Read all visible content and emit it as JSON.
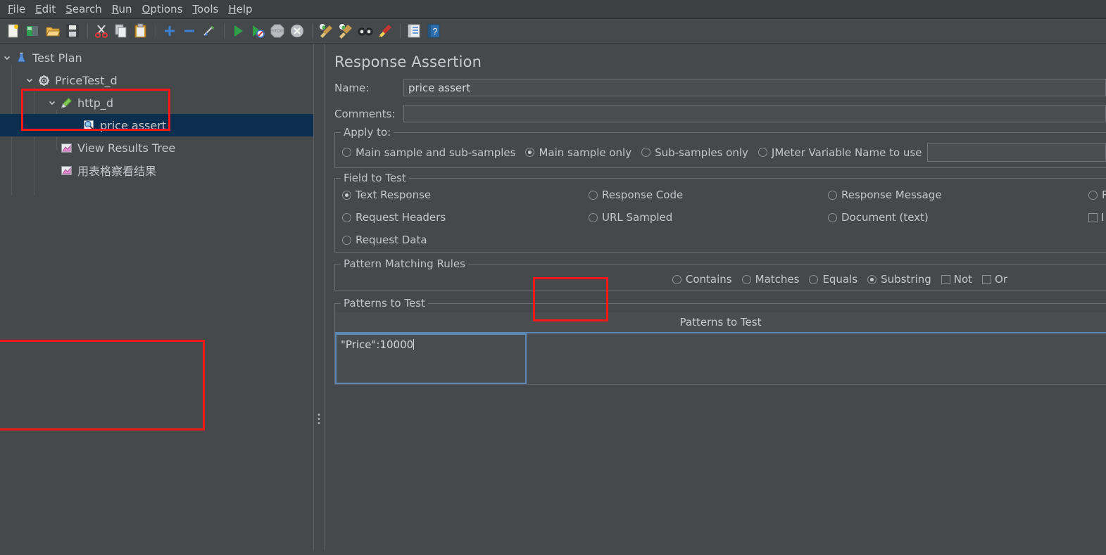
{
  "window": {
    "accent_blue": "#5b88b5",
    "selection_blue": "#0d2f4f",
    "annotation_red": "#f41818",
    "background": "#45494c"
  },
  "menubar": {
    "items": [
      {
        "label": "File",
        "mnemonic": "F"
      },
      {
        "label": "Edit",
        "mnemonic": "E"
      },
      {
        "label": "Search",
        "mnemonic": "S"
      },
      {
        "label": "Run",
        "mnemonic": "R"
      },
      {
        "label": "Options",
        "mnemonic": "O"
      },
      {
        "label": "Tools",
        "mnemonic": "T"
      },
      {
        "label": "Help",
        "mnemonic": "H"
      }
    ]
  },
  "toolbar": {
    "buttons": [
      {
        "name": "new-icon",
        "tooltip": "New"
      },
      {
        "name": "templates-icon",
        "tooltip": "Templates"
      },
      {
        "name": "open-icon",
        "tooltip": "Open"
      },
      {
        "name": "save-icon",
        "tooltip": "Save Test Plan"
      },
      {
        "name": "cut-icon",
        "tooltip": "Cut"
      },
      {
        "name": "copy-icon",
        "tooltip": "Copy"
      },
      {
        "name": "paste-icon",
        "tooltip": "Paste"
      },
      {
        "name": "expand-all-icon",
        "tooltip": "Expand All"
      },
      {
        "name": "collapse-all-icon",
        "tooltip": "Collapse All"
      },
      {
        "name": "toggle-icon",
        "tooltip": "Toggle"
      },
      {
        "name": "start-icon",
        "tooltip": "Start"
      },
      {
        "name": "start-no-pauses-icon",
        "tooltip": "Start no pauses"
      },
      {
        "name": "stop-icon",
        "tooltip": "Stop"
      },
      {
        "name": "shutdown-icon",
        "tooltip": "Shutdown"
      },
      {
        "name": "clear-icon",
        "tooltip": "Clear"
      },
      {
        "name": "clear-all-icon",
        "tooltip": "Clear All"
      },
      {
        "name": "search-icon",
        "tooltip": "Search"
      },
      {
        "name": "reset-search-icon",
        "tooltip": "Reset Search"
      },
      {
        "name": "function-helper-icon",
        "tooltip": "Function Helper Dialog"
      },
      {
        "name": "help-icon",
        "tooltip": "Help"
      }
    ]
  },
  "tree": {
    "nodes": [
      {
        "label": "Test Plan",
        "icon": "test-plan-icon",
        "depth": 0,
        "expanded": true,
        "selected": false,
        "has_toggle": true
      },
      {
        "label": "PriceTest_d",
        "icon": "thread-group-icon",
        "depth": 1,
        "expanded": true,
        "selected": false,
        "has_toggle": true
      },
      {
        "label": "http_d",
        "icon": "http-sampler-icon",
        "depth": 2,
        "expanded": true,
        "selected": false,
        "has_toggle": true
      },
      {
        "label": "price assert",
        "icon": "assertion-icon",
        "depth": 3,
        "expanded": false,
        "selected": true,
        "has_toggle": false
      },
      {
        "label": "View Results Tree",
        "icon": "listener-icon",
        "depth": 2,
        "expanded": false,
        "selected": false,
        "has_toggle": false
      },
      {
        "label": "用表格察看结果",
        "icon": "listener-icon",
        "depth": 2,
        "expanded": false,
        "selected": false,
        "has_toggle": false
      }
    ]
  },
  "editor": {
    "title": "Response Assertion",
    "name_label": "Name:",
    "name_value": "price assert",
    "comments_label": "Comments:",
    "comments_value": "",
    "apply_to": {
      "legend": "Apply to:",
      "options": [
        {
          "label": "Main sample and sub-samples",
          "selected": false
        },
        {
          "label": "Main sample only",
          "selected": true
        },
        {
          "label": "Sub-samples only",
          "selected": false
        },
        {
          "label": "JMeter Variable Name to use",
          "selected": false
        }
      ],
      "variable_value": ""
    },
    "field_to_test": {
      "legend": "Field to Test",
      "options": [
        {
          "label": "Text Response",
          "selected": true,
          "type": "radio"
        },
        {
          "label": "Response Code",
          "selected": false,
          "type": "radio"
        },
        {
          "label": "Response Message",
          "selected": false,
          "type": "radio"
        },
        {
          "label": "R",
          "selected": false,
          "type": "radio",
          "truncated": true
        },
        {
          "label": "Request Headers",
          "selected": false,
          "type": "radio"
        },
        {
          "label": "URL Sampled",
          "selected": false,
          "type": "radio"
        },
        {
          "label": "Document (text)",
          "selected": false,
          "type": "radio"
        },
        {
          "label": "I",
          "selected": false,
          "type": "checkbox",
          "truncated": true
        },
        {
          "label": "Request Data",
          "selected": false,
          "type": "radio"
        }
      ]
    },
    "pattern_matching": {
      "legend": "Pattern Matching Rules",
      "options": [
        {
          "label": "Contains",
          "selected": false,
          "type": "radio"
        },
        {
          "label": "Matches",
          "selected": false,
          "type": "radio"
        },
        {
          "label": "Equals",
          "selected": false,
          "type": "radio"
        },
        {
          "label": "Substring",
          "selected": true,
          "type": "radio"
        },
        {
          "label": "Not",
          "selected": false,
          "type": "checkbox"
        },
        {
          "label": "Or",
          "selected": false,
          "type": "checkbox"
        }
      ]
    },
    "patterns_to_test": {
      "legend": "Patterns to Test",
      "column_header": "Patterns to Test",
      "rows": [
        {
          "value": "\"Price\":10000",
          "editing": true
        }
      ]
    }
  },
  "annotations": [
    {
      "name": "tree-selection-highlight-box"
    },
    {
      "name": "substring-option-highlight-box"
    },
    {
      "name": "pattern-cell-highlight-box"
    }
  ]
}
